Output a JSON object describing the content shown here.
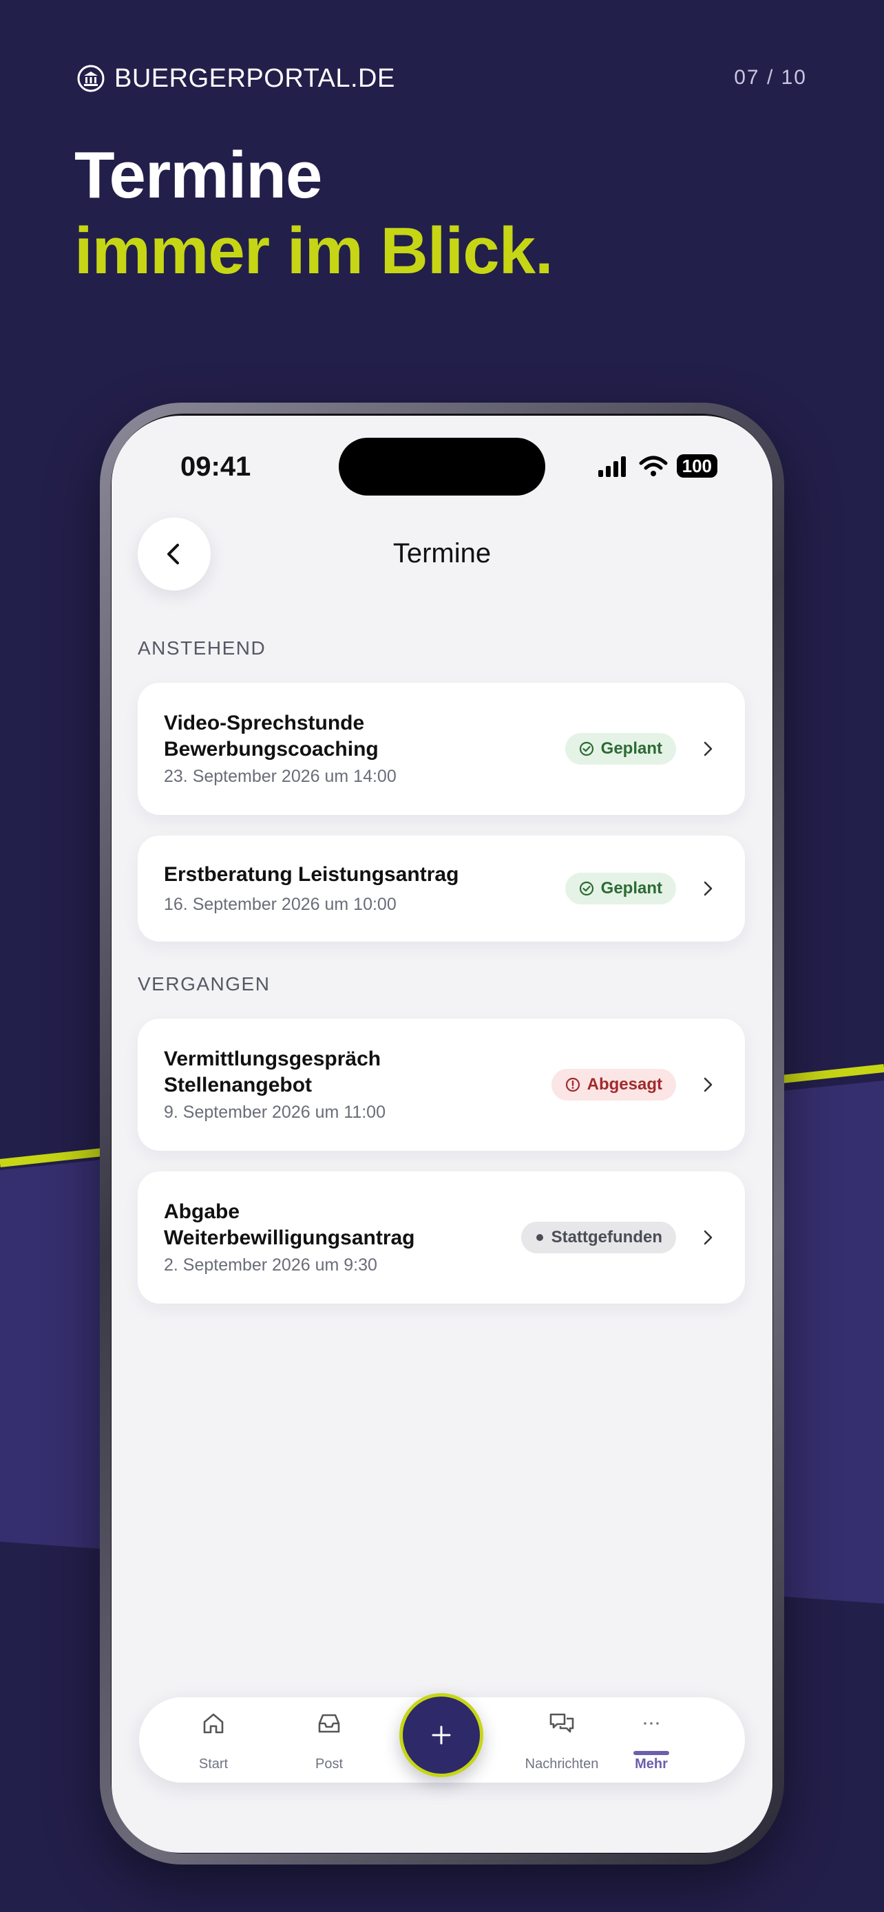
{
  "brand": {
    "name": "BUERGERPORTAL.DE",
    "page_counter": "07 / 10"
  },
  "headline": {
    "line1": "Termine",
    "line2": "immer im Blick."
  },
  "colors": {
    "background": "#231f4b",
    "accent": "#c6d615",
    "primary": "#2e2968",
    "active_tab": "#6b5fad"
  },
  "status_bar": {
    "time": "09:41",
    "battery": "100"
  },
  "header": {
    "title": "Termine",
    "back_icon": "chevron-left-icon"
  },
  "sections": [
    {
      "label": "ANSTEHEND",
      "items": [
        {
          "title_lines": [
            "Video-Sprechstunde",
            "Bewerbungscoaching"
          ],
          "date": "23. September 2026 um 14:00",
          "status": "Geplant",
          "status_icon": "check-circle-icon"
        },
        {
          "title_lines": [
            "Erstberatung Leistungsantrag"
          ],
          "date": "16. September 2026 um 10:00",
          "status": "Geplant",
          "status_icon": "check-circle-icon"
        }
      ]
    },
    {
      "label": "VERGANGEN",
      "items": [
        {
          "title_lines": [
            "Vermittlungsgespräch",
            "Stellenangebot"
          ],
          "date": "9. September 2026 um 11:00",
          "status": "Abgesagt",
          "status_icon": "alert-circle-icon"
        },
        {
          "title_lines": [
            "Abgabe",
            "Weiterbewilligungsantrag"
          ],
          "date": "2. September 2026 um 9:30",
          "status": "Stattgefunden",
          "status_icon": "dot-icon"
        }
      ]
    }
  ],
  "tabbar": {
    "tabs": [
      {
        "label": "Start",
        "icon": "home-icon"
      },
      {
        "label": "Post",
        "icon": "inbox-icon"
      },
      {
        "label": "Nachrichten",
        "icon": "chat-icon"
      },
      {
        "label": "Mehr",
        "icon": "more-icon",
        "active": true
      }
    ],
    "fab_icon": "plus-icon"
  }
}
